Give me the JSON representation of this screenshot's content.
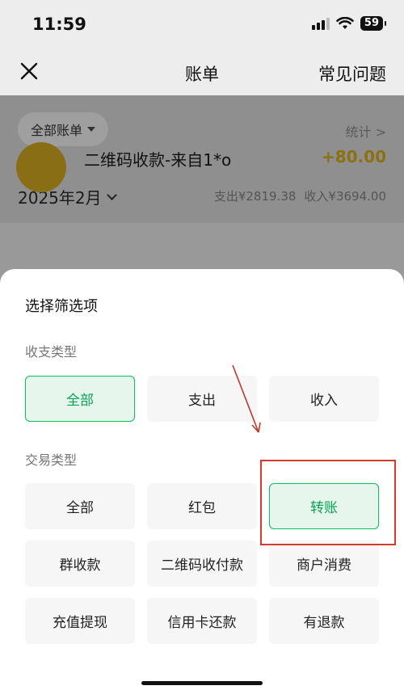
{
  "status": {
    "time": "11:59",
    "battery": "59"
  },
  "nav": {
    "title": "账单",
    "faq": "常见问题"
  },
  "bill": {
    "filter": "全部账单",
    "stats": "统计 >",
    "month": "2025年2月",
    "expense": "支出¥2819.38",
    "income": "收入¥3694.00",
    "tx_name": "二维码收款-来自1*o",
    "tx_amount": "+80.00"
  },
  "sheet": {
    "title": "选择筛选项",
    "group1_label": "收支类型",
    "group1": [
      "全部",
      "支出",
      "收入"
    ],
    "group1_selected": "全部",
    "group2_label": "交易类型",
    "group2": [
      "全部",
      "红包",
      "转账",
      "群收款",
      "二维码收付款",
      "商户消费",
      "充值提现",
      "信用卡还款",
      "有退款"
    ],
    "group2_selected": "转账"
  },
  "colors": {
    "accent": "#07c160",
    "annotation": "#d93a2e"
  }
}
